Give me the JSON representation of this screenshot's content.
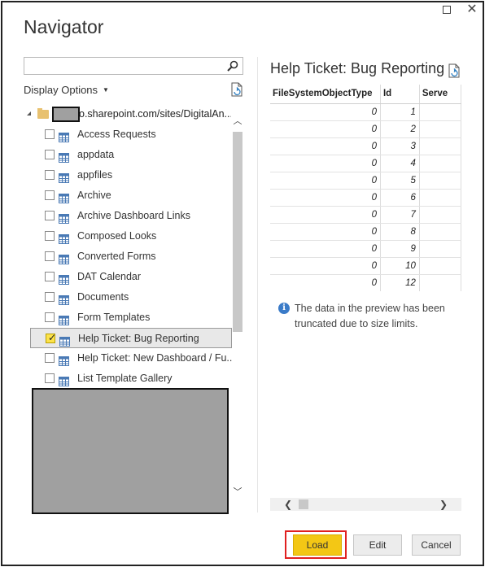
{
  "window": {
    "title": "Navigator"
  },
  "search": {
    "placeholder": "",
    "value": ""
  },
  "display_options": {
    "label": "Display Options"
  },
  "tree": {
    "root_label": "o.sharepoint.com/sites/DigitalAn...",
    "items": [
      {
        "label": "Access Requests",
        "checked": false
      },
      {
        "label": "appdata",
        "checked": false
      },
      {
        "label": "appfiles",
        "checked": false
      },
      {
        "label": "Archive",
        "checked": false
      },
      {
        "label": "Archive Dashboard Links",
        "checked": false
      },
      {
        "label": "Composed Looks",
        "checked": false
      },
      {
        "label": "Converted Forms",
        "checked": false
      },
      {
        "label": "DAT Calendar",
        "checked": false
      },
      {
        "label": "Documents",
        "checked": false
      },
      {
        "label": "Form Templates",
        "checked": false
      },
      {
        "label": "Help Ticket: Bug Reporting",
        "checked": true
      },
      {
        "label": "Help Ticket: New Dashboard / Fu...",
        "checked": false
      },
      {
        "label": "List Template Gallery",
        "checked": false
      }
    ]
  },
  "preview": {
    "title": "Help Ticket: Bug Reporting",
    "columns": [
      "FileSystemObjectType",
      "Id",
      "Serve"
    ],
    "rows": [
      [
        "0",
        "1",
        ""
      ],
      [
        "0",
        "2",
        ""
      ],
      [
        "0",
        "3",
        ""
      ],
      [
        "0",
        "4",
        ""
      ],
      [
        "0",
        "5",
        ""
      ],
      [
        "0",
        "6",
        ""
      ],
      [
        "0",
        "7",
        ""
      ],
      [
        "0",
        "8",
        ""
      ],
      [
        "0",
        "9",
        ""
      ],
      [
        "0",
        "10",
        ""
      ],
      [
        "0",
        "12",
        ""
      ]
    ],
    "info_text": "The data in the preview has been truncated due to size limits."
  },
  "buttons": {
    "load": "Load",
    "edit": "Edit",
    "cancel": "Cancel"
  },
  "colors": {
    "load_accent": "#f3c715",
    "highlight_box": "#e02020",
    "checkbox_checked": "#fce24a"
  }
}
